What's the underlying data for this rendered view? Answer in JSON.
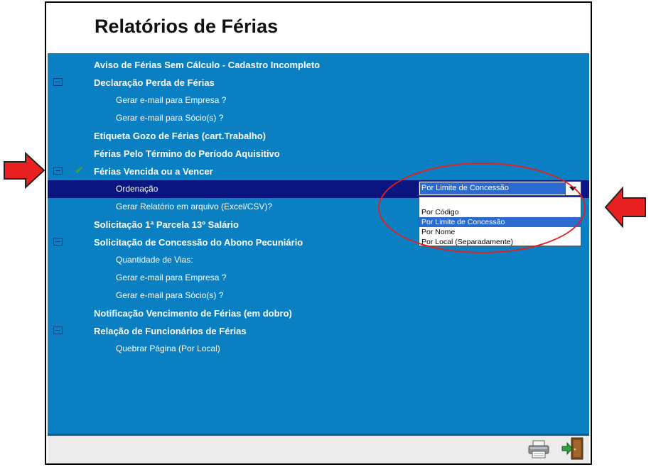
{
  "page": {
    "title": "Relatórios de Férias"
  },
  "tree": {
    "rows": [
      {
        "label": "Aviso de Férias Sem Cálculo - Cadastro Incompleto",
        "level": "main",
        "collapse": false
      },
      {
        "label": "Declaração Perda de Férias",
        "level": "main",
        "collapse": true
      },
      {
        "label": "Gerar e-mail para Empresa ?",
        "level": "sub"
      },
      {
        "label": "Gerar e-mail para Sócio(s) ?",
        "level": "sub"
      },
      {
        "label": "Etiqueta Gozo de Férias (cart.Trabalho)",
        "level": "main",
        "collapse": false
      },
      {
        "label": "Férias Pelo Término do Período Aquisitivo",
        "level": "main",
        "collapse": false
      },
      {
        "label": "Férias Vencida ou a Vencer",
        "level": "main",
        "collapse": true,
        "checked": true
      },
      {
        "label": "Ordenação",
        "level": "sub",
        "selected": true
      },
      {
        "label": "Gerar Relatório em arquivo (Excel/CSV)?",
        "level": "sub"
      },
      {
        "label": "Solicitação 1ª Parcela 13º Salário",
        "level": "main",
        "collapse": false
      },
      {
        "label": "Solicitação de Concessão do Abono Pecuniário",
        "level": "main",
        "collapse": true
      },
      {
        "label": "Quantidade de Vias:",
        "level": "sub"
      },
      {
        "label": "Gerar e-mail para Empresa ?",
        "level": "sub"
      },
      {
        "label": "Gerar e-mail para Sócio(s) ?",
        "level": "sub"
      },
      {
        "label": "Notificação Vencimento de Férias (em dobro)",
        "level": "main",
        "collapse": false
      },
      {
        "label": "Relação de Funcionários de Férias",
        "level": "main",
        "collapse": true
      },
      {
        "label": "Quebrar Página (Por Local)",
        "level": "sub"
      }
    ]
  },
  "ordenacao": {
    "selected_value": "Por Limite de Concessão",
    "options": [
      {
        "label": "Por Código",
        "highlighted": false
      },
      {
        "label": "Por Limite de Concessão",
        "highlighted": true
      },
      {
        "label": "Por Nome",
        "highlighted": false
      },
      {
        "label": "Por Local (Separadamente)",
        "highlighted": false
      }
    ]
  },
  "footer": {
    "icons": [
      "printer-icon",
      "exit-door-icon"
    ]
  },
  "colors": {
    "panel": "#0a7fc2",
    "selected_row": "#0a1580",
    "highlight": "#2b6bcf",
    "annotation": "#e02020",
    "check": "#3aa63a"
  }
}
